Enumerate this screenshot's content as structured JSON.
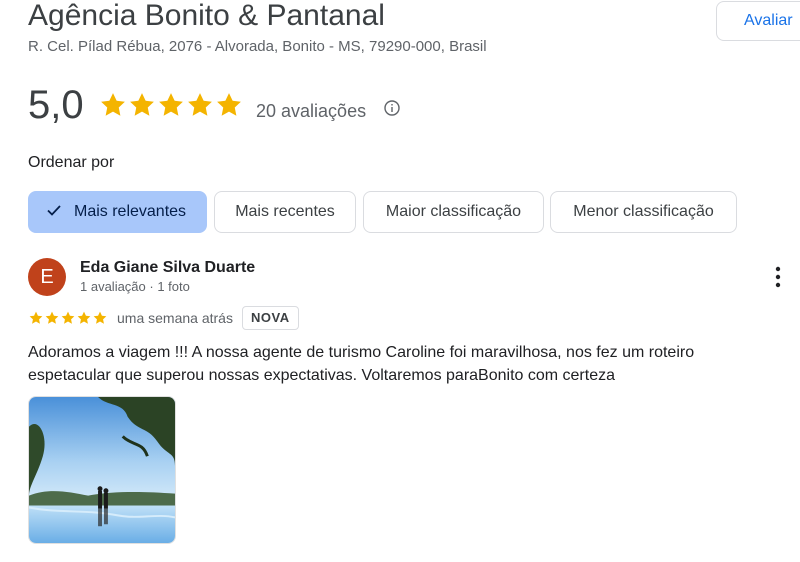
{
  "business": {
    "name": "Agência Bonito & Pantanal",
    "address": "R. Cel. Pílad Rébua, 2076 - Alvorada, Bonito - MS, 79290-000, Brasil",
    "write_review_label": "Avaliar"
  },
  "rating": {
    "score": "5,0",
    "stars": 5,
    "count_label": "20 avaliações",
    "star_color": "#f4b400"
  },
  "sort": {
    "label": "Ordenar por",
    "options": [
      {
        "label": "Mais relevantes",
        "selected": true
      },
      {
        "label": "Mais recentes",
        "selected": false
      },
      {
        "label": "Maior classificação",
        "selected": false
      },
      {
        "label": "Menor classificação",
        "selected": false
      }
    ]
  },
  "review": {
    "avatar_initial": "E",
    "avatar_color": "#c0421b",
    "author": "Eda Giane Silva Duarte",
    "author_meta": "1 avaliação · 1 foto",
    "stars": 5,
    "date": "uma semana atrás",
    "badge": "NOVA",
    "text": "Adoramos a viagem !!! A nossa agente de turismo Caroline foi maravilhosa, nos fez um roteiro espetacular que superou nossas expectativas. Voltaremos paraBonito com certeza",
    "photo_icon": "review-photo"
  },
  "colors": {
    "accent": "#1a73e8",
    "chip_selected_bg": "#a8c7fa"
  }
}
